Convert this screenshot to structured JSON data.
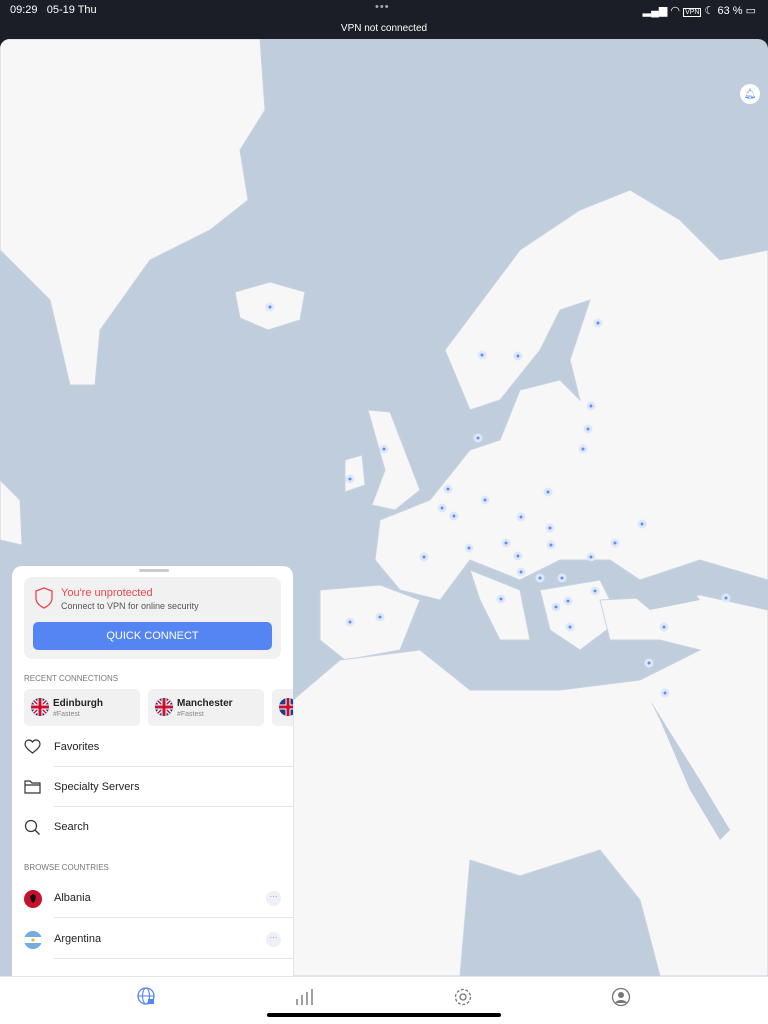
{
  "status_bar": {
    "time": "09:29",
    "date": "05-19 Thu",
    "dots": "•••",
    "indicators": "VPN",
    "battery": "63 %",
    "vpn_status": "VPN not connected"
  },
  "map": {
    "ocean_color": "#c0cddc",
    "land_color": "#f7f7f8",
    "server_dot_color": "#5b8ff9",
    "bell_icon": "bell-icon"
  },
  "panel": {
    "status_title": "You're unprotected",
    "status_subtitle": "Connect to VPN for online security",
    "quick_connect": "QUICK CONNECT",
    "recent_header": "RECENT CONNECTIONS",
    "recent": [
      {
        "name": "Edinburgh",
        "sub": "#Fastest"
      },
      {
        "name": "Manchester",
        "sub": "#Fastest"
      }
    ],
    "menu": [
      {
        "label": "Favorites",
        "icon": "heart-icon"
      },
      {
        "label": "Specialty Servers",
        "icon": "folder-icon"
      },
      {
        "label": "Search",
        "icon": "search-icon"
      }
    ],
    "browse_header": "BROWSE COUNTRIES",
    "countries": [
      {
        "name": "Albania"
      },
      {
        "name": "Argentina"
      }
    ]
  },
  "tabs": [
    {
      "name": "map",
      "icon": "globe-lock-icon",
      "active": true
    },
    {
      "name": "stats",
      "icon": "bars-icon"
    },
    {
      "name": "settings",
      "icon": "gear-icon"
    },
    {
      "name": "profile",
      "icon": "profile-icon"
    }
  ],
  "accent": "#5585f2"
}
